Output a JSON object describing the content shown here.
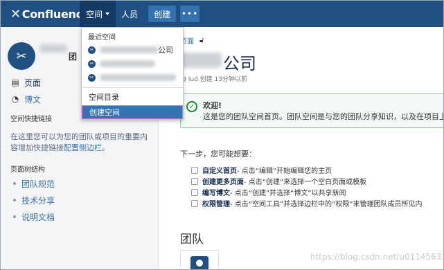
{
  "header": {
    "logo": "Confluence",
    "nav": {
      "spaces": "空间",
      "people": "人员"
    },
    "create": "创建",
    "more": "•••"
  },
  "dropdown": {
    "recent_header": "最近空间",
    "recent_spaces": [
      {
        "suffix": "公司"
      },
      {
        "suffix": ""
      },
      {
        "suffix": ""
      }
    ],
    "directory": "空间目录",
    "create_space": "创建空间"
  },
  "sidebar": {
    "space_name_suffix": "团",
    "pages": "页面",
    "blog": "博文",
    "shortcuts_title": "空间快捷链接",
    "shortcuts_text": "在这里您可以为您的团队或项目的重要内容增加快捷链接",
    "shortcuts_link": "配置侧边栏",
    "shortcuts_end": "。",
    "tree_title": "页面树结构",
    "tree": [
      "团队规范",
      "技术分享",
      "说明文档"
    ]
  },
  "main": {
    "breadcrumb": "页面",
    "title_suffix": "公司",
    "meta": "由 lud   创建 13分钟以前",
    "welcome_title": "欢迎!",
    "welcome_text": "这是您的团队空间首页。团队空间是与您的团队分享知识，以及在项目上",
    "next_steps": "下一步，您可能想要：",
    "todos": [
      {
        "bold": "自定义首页",
        "text": " - 点击“编辑”开始编辑您的主页"
      },
      {
        "bold": "创建更多页面",
        "text": " - 点击“创建”来选择一个空白页面或模板"
      },
      {
        "bold": "编写博文",
        "text": " - 点击“创建”并选择“博文”以共享新闻"
      },
      {
        "bold": "权限管理",
        "text": " - 点击“空间工具”并选择边栏中的“权限”来管理团队成员所见内"
      }
    ],
    "team_heading": "团队",
    "watermark": "https://blog.csdn.net/u011456337"
  },
  "colors": {
    "topbar": "#205081",
    "accent": "#3572b0",
    "success": "#14892c"
  }
}
